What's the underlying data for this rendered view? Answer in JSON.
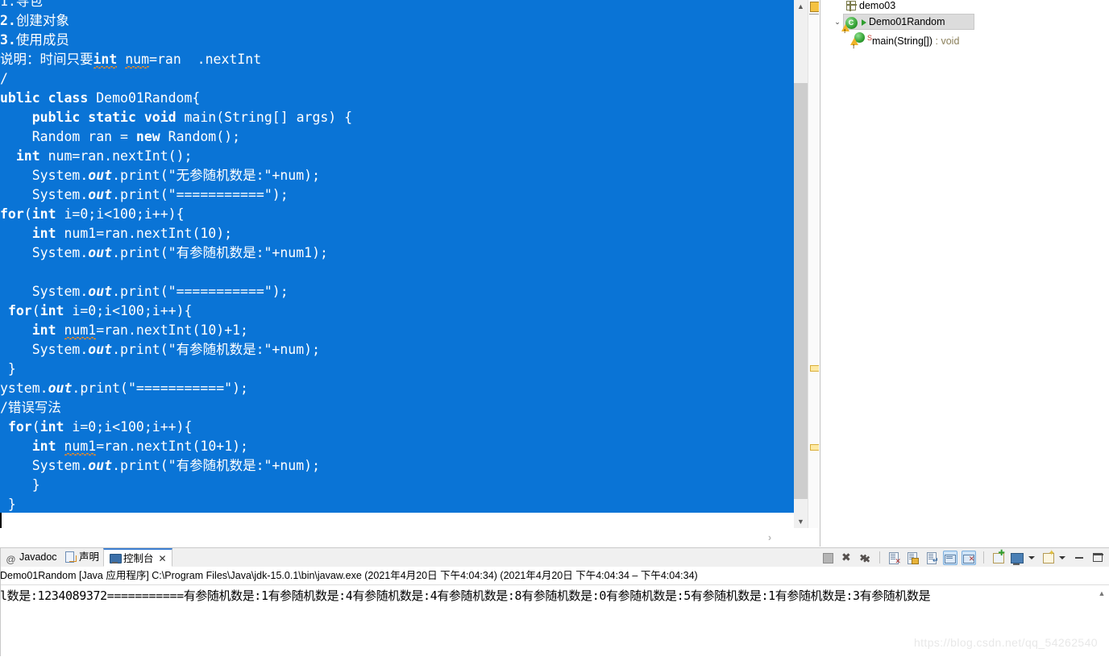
{
  "editor": {
    "code_lines": [
      "1.导包",
      "2.创建对象",
      "3.使用成员",
      "说明：时间只要int num=ran .nextInt",
      "/",
      "ublic class Demo01Random{",
      "    public static void main(String[] args) {",
      "    Random ran = new Random();",
      "  int num=ran.nextInt();",
      "    System.out.print(\"无参随机数是:\"+num);",
      "    System.out.print(\"===========\");",
      "for(int i=0;i<100;i++){",
      "    int num1=ran.nextInt(10);",
      "    System.out.print(\"有参随机数是:\"+num1);",
      "",
      "    System.out.print(\"===========\");",
      " for(int i=0;i<100;i++){",
      "    int num1=ran.nextInt(10)+1;",
      "    System.out.print(\"有参随机数是:\"+num);",
      " }",
      "ystem.out.print(\"===========\");",
      "/错误写法",
      " for(int i=0;i<100;i++){",
      "    int num1=ran.nextInt(10+1);",
      "    System.out.print(\"有参随机数是:\"+num);",
      "    }",
      " }"
    ],
    "selection_color": "#0a74d6",
    "selection_text_color": "#ffffff"
  },
  "outline": {
    "items": [
      {
        "label": "demo03",
        "icon": "package-icon",
        "indent": 0
      },
      {
        "label": "Demo01Random",
        "icon": "class-icon",
        "indent": 0,
        "selected": true,
        "expanded": true
      },
      {
        "label": "main(String[])",
        "return_type": " : void",
        "icon": "method-icon",
        "modifier": "S",
        "indent": 1
      }
    ]
  },
  "bottom": {
    "tabs": [
      {
        "label": "Javadoc",
        "icon": "javadoc-icon",
        "active": false
      },
      {
        "label": "声明",
        "icon": "declaration-icon",
        "active": false
      },
      {
        "label": "控制台",
        "icon": "console-icon",
        "active": true,
        "close": "✕"
      }
    ],
    "toolbar_icons": [
      "terminate-icon",
      "remove-launch-icon",
      "remove-all-launches-icon",
      "clear-console-icon",
      "scroll-lock-icon",
      "show-console-on-output-icon",
      "pin-console-icon",
      "display-selected-console-icon",
      "open-console-icon",
      "new-console-view-icon",
      "minimize-icon",
      "maximize-icon"
    ],
    "console_header": "Demo01Random [Java 应用程序] C:\\Program Files\\Java\\jdk-15.0.1\\bin\\javaw.exe  (2021年4月20日 下午4:04:34)  (2021年4月20日 下午4:04:34 – 下午4:04:34)",
    "console_output": "l数是:1234089372===========有参随机数是:1有参随机数是:4有参随机数是:4有参随机数是:8有参随机数是:0有参随机数是:5有参随机数是:1有参随机数是:3有参随机数是"
  },
  "watermark": "https://blog.csdn.net/qq_54262540",
  "glyphs": {
    "chevron_up": "▲",
    "chevron_down": "▼",
    "twisty_down": "⌄",
    "twisty_right": "›",
    "hscroll_arrow": "›",
    "at_sign": "@"
  }
}
